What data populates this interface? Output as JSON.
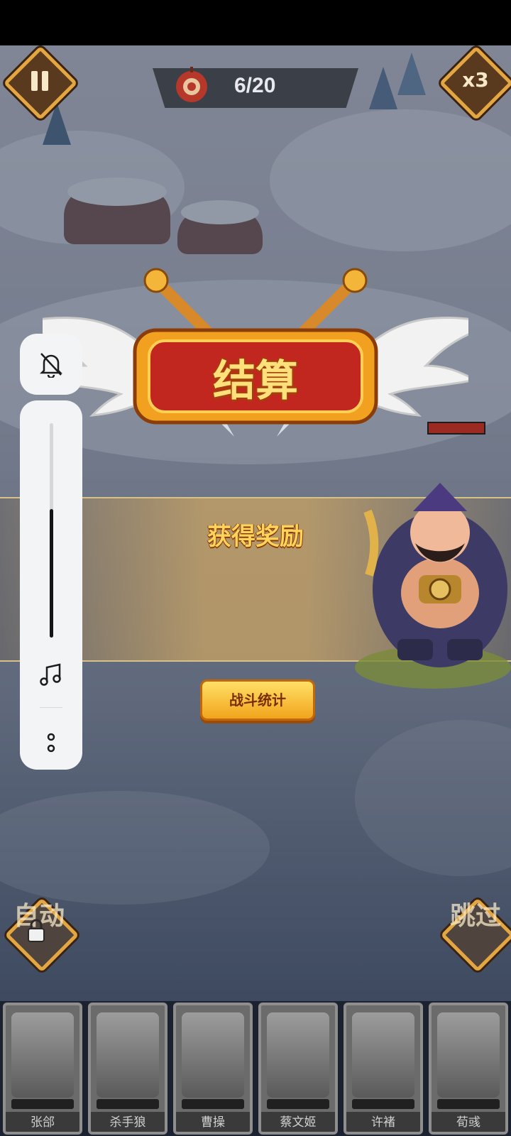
{
  "top": {
    "pause_icon": "pause-icon",
    "wave": "6/20",
    "speed": "x3"
  },
  "result": {
    "title": "结算",
    "reward_title": "获得奖励",
    "stats_button": "战斗统计"
  },
  "bottom_left": {
    "label": "自动",
    "icon": "lock-icon"
  },
  "bottom_right": {
    "label": "跳过"
  },
  "volume": {
    "bell_icon": "bell-off-icon",
    "music_icon": "music-note-icon",
    "more_icon": "more-dots-icon",
    "level": 0.6
  },
  "enemy_hp_fraction": 1.0,
  "heroes": [
    {
      "name": "张郃"
    },
    {
      "name": "杀手狼"
    },
    {
      "name": "曹操"
    },
    {
      "name": "蔡文姬"
    },
    {
      "name": "许褚"
    },
    {
      "name": "荀彧"
    }
  ]
}
